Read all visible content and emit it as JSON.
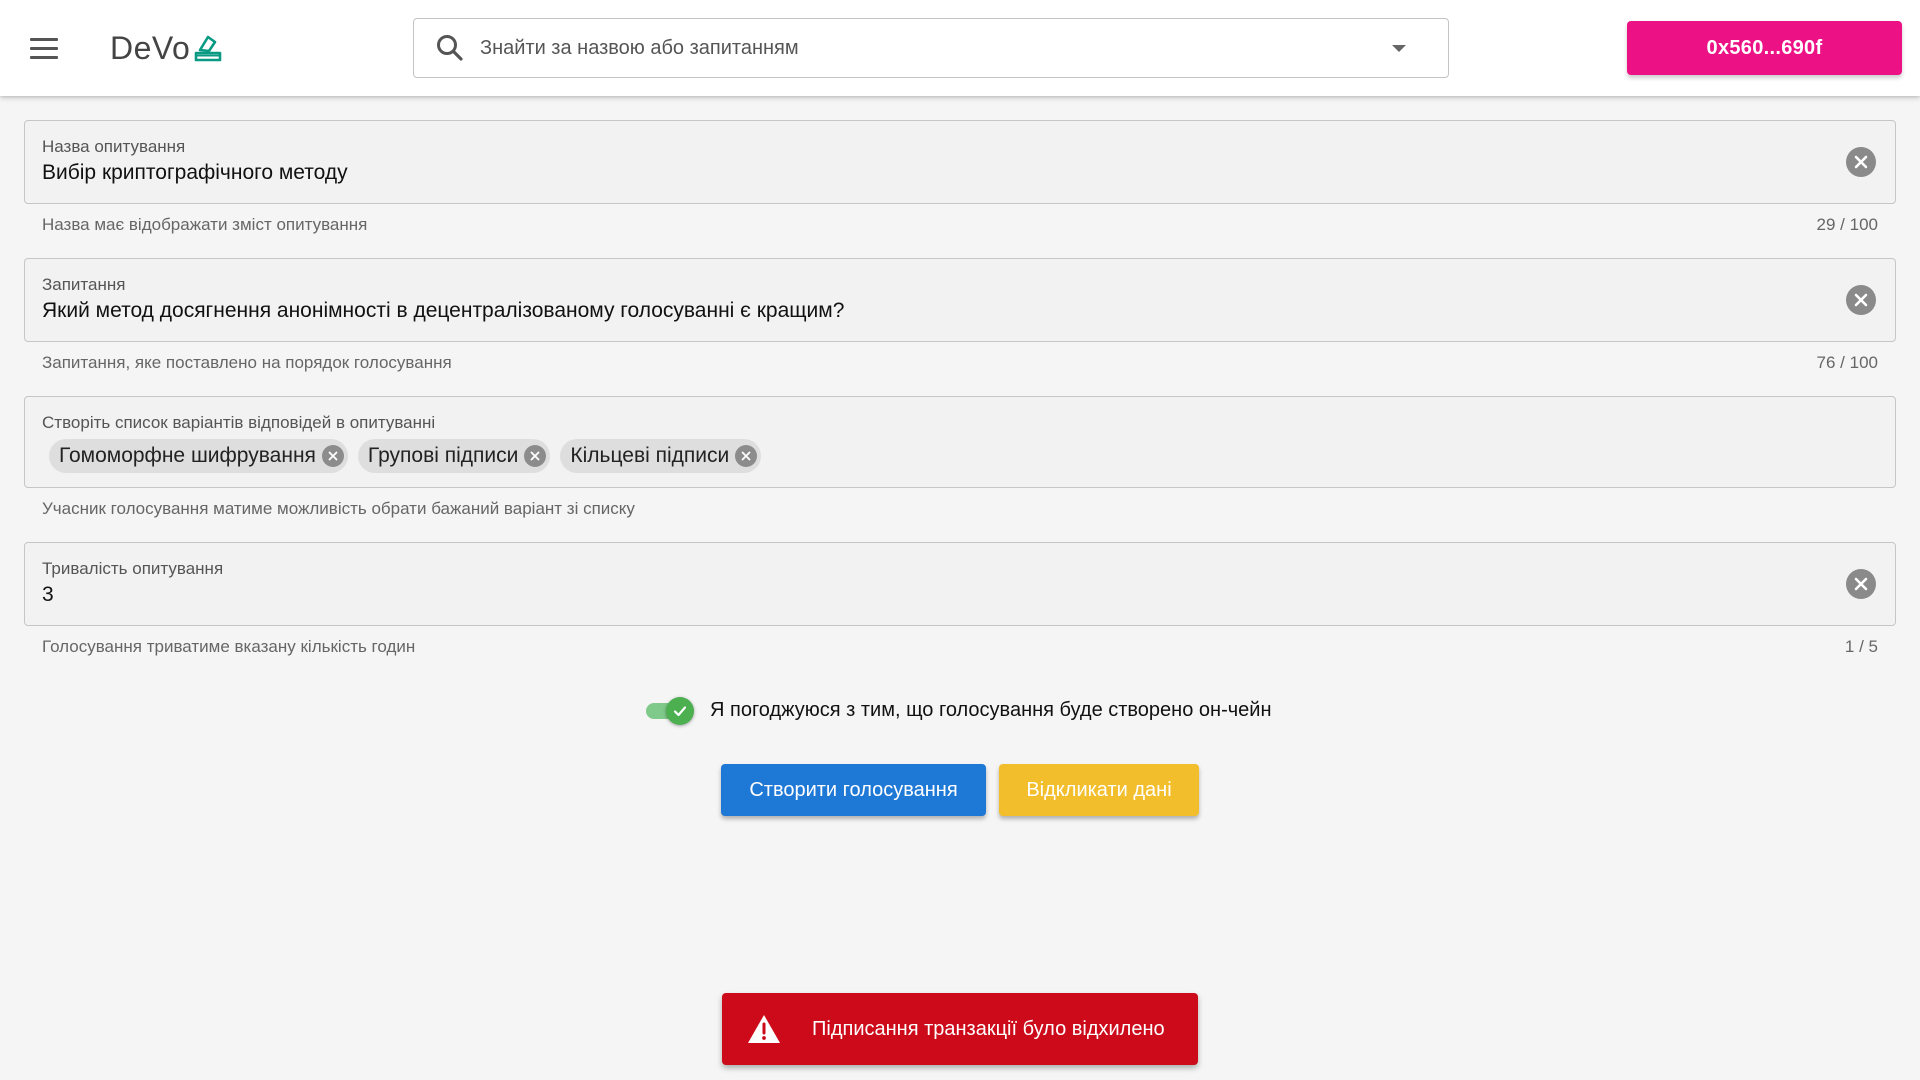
{
  "header": {
    "logo_text": "DeVo",
    "search_placeholder": "Знайти за назвою або запитанням",
    "wallet_label": "0x560...690f",
    "wallet_color": "#ec1185"
  },
  "form": {
    "title_field": {
      "label": "Назва опитування",
      "value": "Вибір криптографічного методу",
      "hint": "Назва має відображати зміст опитування",
      "counter": "29 / 100"
    },
    "question_field": {
      "label": "Запитання",
      "value": "Який метод досягнення анонімності в децентралізованому голосуванні є кращим?",
      "hint": "Запитання, яке поставлено на порядок голосування",
      "counter": "76 / 100"
    },
    "options_field": {
      "label": "Створіть список варіантів відповідей в опитуванні",
      "chips": [
        "Гомоморфне шифрування",
        "Групові підписи",
        "Кільцеві підписи"
      ],
      "hint": "Учасник голосування матиме можливість обрати бажаний варіант зі списку"
    },
    "duration_field": {
      "label": "Тривалість опитування",
      "value": "3",
      "hint": "Голосування триватиме вказану кількість годин",
      "counter": "1 / 5"
    },
    "onchain_toggle": {
      "label": "Я погоджуюся з тим, що голосування буде створено он-чейн",
      "checked": true
    },
    "create_button": "Створити голосування",
    "reset_button": "Відкликати дані"
  },
  "snackbar": {
    "icon": "warning-icon",
    "message": "Підписання транзакції було відхилено",
    "color": "#cc0a1a"
  }
}
